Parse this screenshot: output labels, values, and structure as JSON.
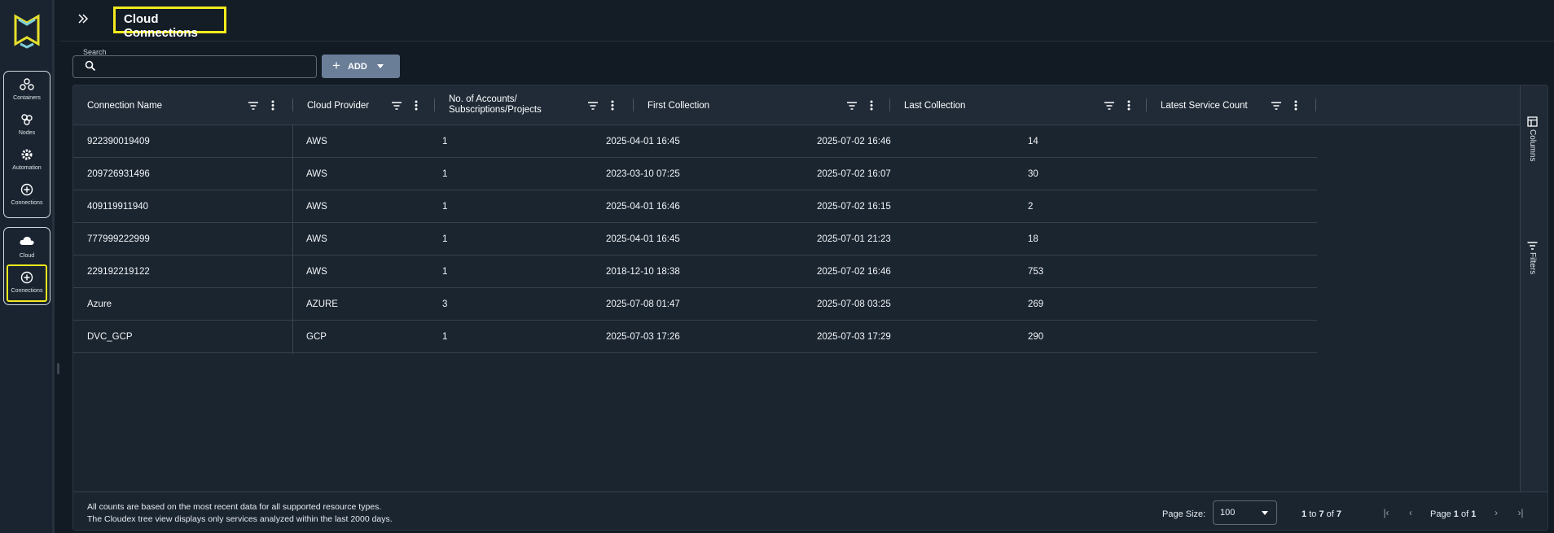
{
  "sidebar": {
    "logo": "cloudex-logo",
    "group1": [
      {
        "label": "Containers",
        "icon": "containers-icon"
      },
      {
        "label": "Nodes",
        "icon": "nodes-icon"
      },
      {
        "label": "Automation",
        "icon": "gear-icon"
      },
      {
        "label": "Connections",
        "icon": "plus-circle-icon"
      }
    ],
    "group2": [
      {
        "label": "Cloud",
        "icon": "cloud-icon"
      },
      {
        "label": "Connections",
        "icon": "plus-circle-icon",
        "selected": true
      }
    ]
  },
  "header": {
    "title": "Cloud Connections",
    "expand_icon": "double-chevron-right-icon"
  },
  "toolbar": {
    "search_label": "Search",
    "search_value": "",
    "add_label": "ADD"
  },
  "table": {
    "columns": [
      {
        "label": "Connection Name"
      },
      {
        "label": "Cloud Provider"
      },
      {
        "label": "No. of Accounts/",
        "label2": "Subscriptions/Projects"
      },
      {
        "label": "First Collection"
      },
      {
        "label": "Last Collection"
      },
      {
        "label": "Latest Service Count"
      }
    ],
    "rows": [
      [
        "922390019409",
        "AWS",
        "1",
        "2025-04-01 16:45",
        "2025-07-02 16:46",
        "14"
      ],
      [
        "209726931496",
        "AWS",
        "1",
        "2023-03-10 07:25",
        "2025-07-02 16:07",
        "30"
      ],
      [
        "409119911940",
        "AWS",
        "1",
        "2025-04-01 16:46",
        "2025-07-02 16:15",
        "2"
      ],
      [
        "777999222999",
        "AWS",
        "1",
        "2025-04-01 16:45",
        "2025-07-01 21:23",
        "18"
      ],
      [
        "229192219122",
        "AWS",
        "1",
        "2018-12-10 18:38",
        "2025-07-02 16:46",
        "753"
      ],
      [
        "Azure",
        "AZURE",
        "3",
        "2025-07-08 01:47",
        "2025-07-08 03:25",
        "269"
      ],
      [
        "DVC_GCP",
        "GCP",
        "1",
        "2025-07-03 17:26",
        "2025-07-03 17:29",
        "290"
      ]
    ]
  },
  "side_panel": {
    "columns_label": "Columns",
    "filters_label": "Filters"
  },
  "footer": {
    "note1": "All counts are based on the most recent data for all supported resource types.",
    "note2": "The Cloudex tree view displays only services analyzed within the last 2000 days.",
    "page_size_label": "Page Size:",
    "page_size_value": "100",
    "range_from": "1",
    "range_to_word": "to",
    "range_to": "7",
    "range_of_word": "of",
    "range_total": "7",
    "page_word": "Page",
    "page_current": "1",
    "page_of_word": "of",
    "page_total": "1"
  },
  "colors": {
    "accent_highlight": "#f2ea1d",
    "add_button": "#6a7e98",
    "background": "#121a24"
  }
}
